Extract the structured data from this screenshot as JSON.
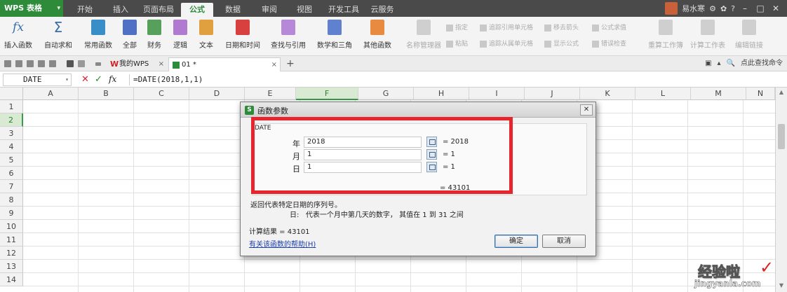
{
  "app": {
    "title": "WPS 表格",
    "brand_color": "#2e8b3a"
  },
  "menu": {
    "tabs": [
      "开始",
      "插入",
      "页面布局",
      "公式",
      "数据",
      "审阅",
      "视图",
      "开发工具",
      "云服务"
    ],
    "active": "公式",
    "user": "易水寒"
  },
  "ribbon": {
    "groups": [
      {
        "label": "插入函数",
        "icon": "fx-icon"
      },
      {
        "label": "自动求和",
        "icon": "sigma-icon"
      },
      {
        "label": "常用函数",
        "icon": "star-icon"
      },
      {
        "label": "全部",
        "icon": "book-icon"
      },
      {
        "label": "财务",
        "icon": "finance-icon"
      },
      {
        "label": "逻辑",
        "icon": "logic-icon"
      },
      {
        "label": "文本",
        "icon": "text-icon"
      },
      {
        "label": "日期和时间",
        "icon": "calendar-icon"
      },
      {
        "label": "查找与引用",
        "icon": "lookup-icon"
      },
      {
        "label": "数学和三角",
        "icon": "math-icon"
      },
      {
        "label": "其他函数",
        "icon": "grid-icon"
      },
      {
        "label": "名称管理器",
        "icon": "name-manager-icon"
      }
    ],
    "small_items": [
      "指定",
      "粘贴",
      "追踪引用单元格",
      "追踪从属单元格",
      "移去箭头",
      "显示公式",
      "公式求值",
      "错误检查",
      "重算工作簿",
      "计算工作表",
      "编辑链接"
    ]
  },
  "doc_tabs": [
    {
      "label": "我的WPS",
      "active": false
    },
    {
      "label": "01 *",
      "active": true
    }
  ],
  "toolbar_right": {
    "search_label": "点此查找命令"
  },
  "formula_bar": {
    "name_box": "DATE",
    "formula": "=DATE(2018,1,1)"
  },
  "grid": {
    "columns": [
      "A",
      "B",
      "C",
      "D",
      "E",
      "F",
      "G",
      "H",
      "I",
      "J",
      "K",
      "L",
      "M",
      "N"
    ],
    "rows": [
      "1",
      "2",
      "3",
      "4",
      "5",
      "6",
      "7",
      "8",
      "9",
      "10",
      "11",
      "12",
      "13",
      "14"
    ],
    "selected_column": "F",
    "selected_row": "2"
  },
  "dialog": {
    "title": "函数参数",
    "function_name": "DATE",
    "args": [
      {
        "label": "年",
        "value": "2018",
        "result": "= 2018"
      },
      {
        "label": "月",
        "value": "1",
        "result": "= 1"
      },
      {
        "label": "日",
        "value": "1",
        "result": "= 1"
      }
    ],
    "formula_result": "= 43101",
    "description": "返回代表特定日期的序列号。",
    "arg_description_label": "日:",
    "arg_description_text": "代表一个月中第几天的数字， 其值在 1 到 31 之间",
    "calc_result": "计算结果 = 43101",
    "help_link": "有关该函数的帮助(H)",
    "ok_label": "确定",
    "cancel_label": "取消"
  },
  "watermark": {
    "logo": "经验啦",
    "url": "jingyanla.com",
    "check": "✓"
  }
}
